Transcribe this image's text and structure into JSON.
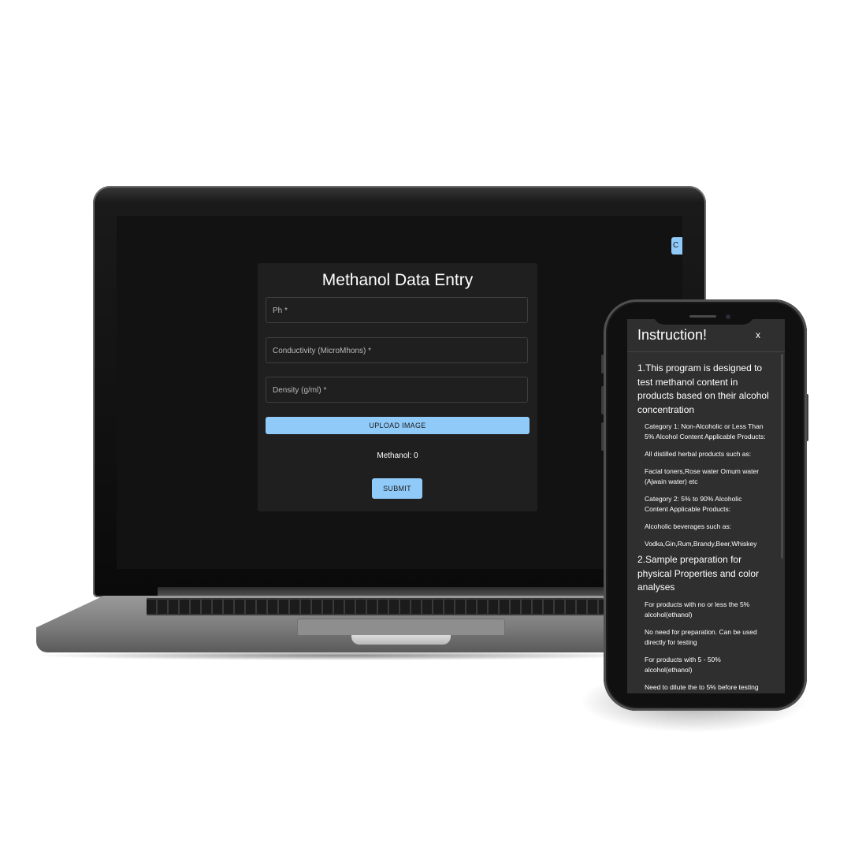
{
  "form": {
    "title": "Methanol Data Entry",
    "corner_button_label": "C",
    "fields": [
      {
        "label": "Ph *"
      },
      {
        "label": "Conductivity (MicroMhons) *"
      },
      {
        "label": "Density (g/ml) *"
      }
    ],
    "upload_label": "UPLOAD IMAGE",
    "methanol_result": "Methanol: 0",
    "submit_label": "SUBMIT"
  },
  "dialog": {
    "title": "Instruction!",
    "close_label": "x",
    "section1_heading": "1.This program is designed to test methanol content in products based on their alcohol concentration",
    "section1_items": [
      "Category 1: Non-Alcoholic or Less Than 5% Alcohol Content Applicable Products:",
      "All distilled herbal products such as:",
      "Facial toners,Rose water Omum water (Ajwain water) etc",
      "Category 2: 5% to 90% Alcoholic Content Applicable Products:",
      "Alcoholic beverages such as:",
      "Vodka,Gin,Rum,Brandy,Beer,Whiskey"
    ],
    "section2_heading": "2.Sample preparation for physical Properties and color analyses",
    "section2_items": [
      "For products with no or less the 5% alcohol(ethanol)",
      "No need for preparation. Can be used directly for testing",
      "For products with 5 - 50% alcohol(ethanol)",
      "Need to dilute the to 5% before testing"
    ]
  },
  "colors": {
    "accent": "#90caf9",
    "screen_background": "#121212",
    "card_background": "#1f1f1f",
    "dialog_background": "#2f2f2f"
  }
}
